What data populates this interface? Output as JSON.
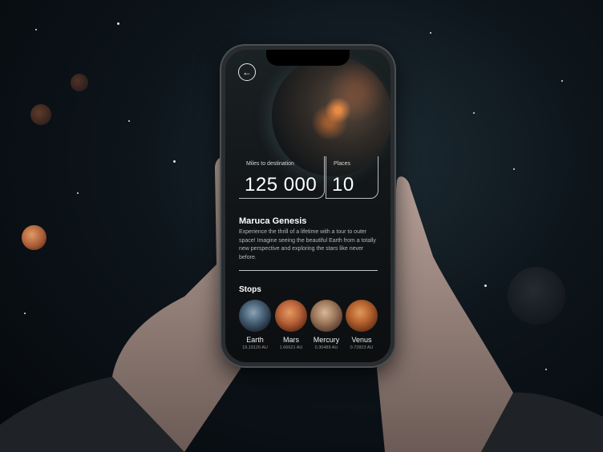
{
  "screen": {
    "back_icon": "arrow-left-icon",
    "miles_label": "Miles to destination",
    "miles_value": "125 000",
    "places_label": "Places",
    "places_value": "10",
    "tour_title": "Maruca Genesis",
    "tour_description": "Experience the thrill of a lifetime with a tour to outer space! Imagine seeing the beautiful Earth from a totally new perspective and exploring the stars like never before.",
    "stops_title": "Stops",
    "stops": [
      {
        "name": "Earth",
        "distance": "19,19126 AU"
      },
      {
        "name": "Mars",
        "distance": "1.66621 AU"
      },
      {
        "name": "Mercury",
        "distance": "0.30489 AU"
      },
      {
        "name": "Venus",
        "distance": "0.72823 AU"
      }
    ]
  },
  "colors": {
    "background": "#0d151b",
    "screen": "#121618",
    "text_primary": "#ffffff",
    "text_secondary": "#b4b8ba"
  }
}
